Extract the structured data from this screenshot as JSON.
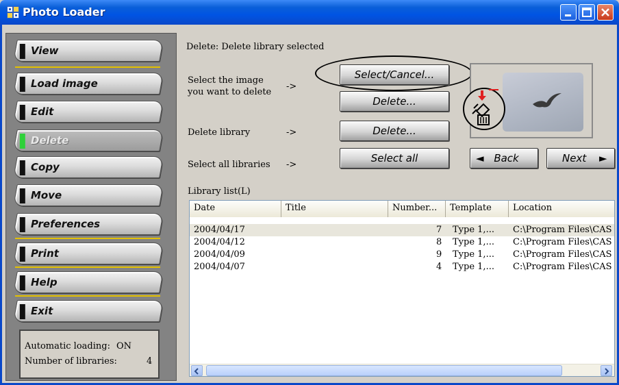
{
  "window": {
    "title": "Photo Loader",
    "controls": {
      "minimize": "minimize-icon",
      "maximize": "maximize-icon",
      "close": "close-icon"
    },
    "colors": {
      "titlebar": "#0054e3",
      "close": "#c9391a"
    }
  },
  "sidebar": {
    "items": [
      {
        "label": "View",
        "state": "normal"
      },
      {
        "label": "Load image",
        "state": "normal"
      },
      {
        "label": "Edit",
        "state": "normal"
      },
      {
        "label": "Delete",
        "state": "active"
      },
      {
        "label": "Copy",
        "state": "normal"
      },
      {
        "label": "Move",
        "state": "normal"
      },
      {
        "label": "Preferences",
        "state": "normal"
      },
      {
        "label": "Print",
        "state": "normal"
      },
      {
        "label": "Help",
        "state": "normal"
      },
      {
        "label": "Exit",
        "state": "normal"
      }
    ],
    "status": {
      "auto_loading_label": "Automatic loading:",
      "auto_loading_value": "ON",
      "libraries_label": "Number of libraries:",
      "libraries_value": "4"
    }
  },
  "main": {
    "heading": "Delete: Delete library selected",
    "select_image_text_1": "Select the image",
    "select_image_text_2": "you want to delete",
    "delete_library_text": "Delete library",
    "select_all_text": "Select all libraries",
    "arrow": "->",
    "buttons": {
      "select_cancel": "Select/Cancel...",
      "delete_image": "Delete...",
      "delete_library": "Delete...",
      "select_all": "Select all",
      "back": "Back",
      "next": "Next"
    }
  },
  "library_list": {
    "label": "Library list(L)",
    "columns": [
      "Date",
      "Title",
      "Number...",
      "Template",
      "Location"
    ],
    "rows": [
      {
        "date": "2004/04/17",
        "title": "",
        "number": "7",
        "template": "Type 1,...",
        "location": "C:\\Program Files\\CAS",
        "selected": true
      },
      {
        "date": "2004/04/12",
        "title": "",
        "number": "8",
        "template": "Type 1,...",
        "location": "C:\\Program Files\\CAS",
        "selected": false
      },
      {
        "date": "2004/04/09",
        "title": "",
        "number": "9",
        "template": "Type 1,...",
        "location": "C:\\Program Files\\CAS",
        "selected": false
      },
      {
        "date": "2004/04/07",
        "title": "",
        "number": "4",
        "template": "Type 1,...",
        "location": "C:\\Program Files\\CAS",
        "selected": false
      }
    ]
  },
  "icons": {
    "app": "photo-loader-app-icon",
    "delete": "delete-trash-icon",
    "preview": "bird-photo-thumbnail"
  }
}
